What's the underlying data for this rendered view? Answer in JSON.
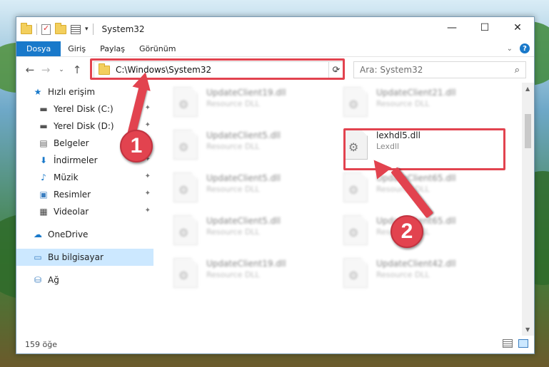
{
  "window": {
    "title": "System32"
  },
  "ribbon": {
    "tabs": [
      "Dosya",
      "Giriş",
      "Paylaş",
      "Görünüm"
    ]
  },
  "address": {
    "path": "C:\\Windows\\System32"
  },
  "search": {
    "placeholder": "Ara: System32"
  },
  "sidebar": {
    "items": [
      {
        "label": "Hızlı erişim",
        "icon": "star-icon"
      },
      {
        "label": "Yerel Disk (C:)",
        "icon": "drive-icon"
      },
      {
        "label": "Yerel Disk (D:)",
        "icon": "drive-icon"
      },
      {
        "label": "Belgeler",
        "icon": "documents-icon"
      },
      {
        "label": "İndirmeler",
        "icon": "download-icon"
      },
      {
        "label": "Müzik",
        "icon": "music-icon"
      },
      {
        "label": "Resimler",
        "icon": "pictures-icon"
      },
      {
        "label": "Videolar",
        "icon": "videos-icon"
      },
      {
        "label": "OneDrive",
        "icon": "cloud-icon"
      },
      {
        "label": "Bu bilgisayar",
        "icon": "computer-icon"
      },
      {
        "label": "Ağ",
        "icon": "network-icon"
      }
    ]
  },
  "files": [
    {
      "name": "UpdateClient19.dll",
      "desc": "Resource DLL"
    },
    {
      "name": "UpdateClient21.dll",
      "desc": "Resource DLL"
    },
    {
      "name": "UpdateClient5.dll",
      "desc": "Resource DLL"
    },
    {
      "name": "lexhdl5.dll",
      "desc": "Lexdll"
    },
    {
      "name": "UpdateClient5.dll",
      "desc": "Resource DLL"
    },
    {
      "name": "UpdateClient65.dll",
      "desc": "Resource DLL"
    },
    {
      "name": "UpdateClient5.dll",
      "desc": "Resource DLL"
    },
    {
      "name": "UpdateClient65.dll",
      "desc": "Resource DLL"
    },
    {
      "name": "UpdateClient19.dll",
      "desc": "Resource DLL"
    },
    {
      "name": "UpdateClient42.dll",
      "desc": "Resource DLL"
    }
  ],
  "status": {
    "count": "159 öğe"
  },
  "annotations": {
    "step1": "1",
    "step2": "2"
  },
  "colors": {
    "accent": "#1979ca",
    "highlight": "#e2434f",
    "selected": "#cce8ff"
  }
}
